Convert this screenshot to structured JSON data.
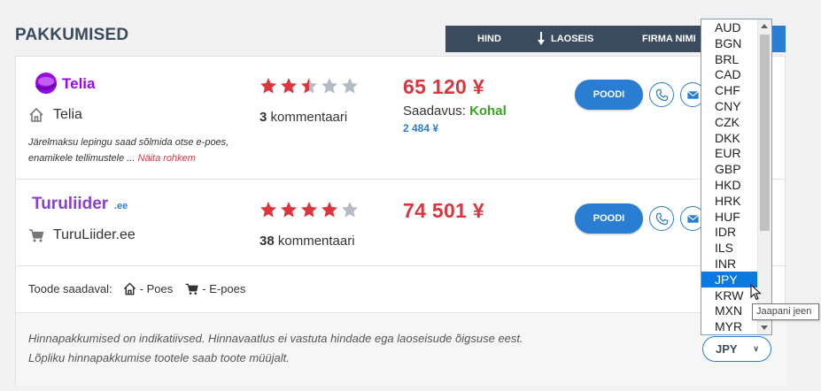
{
  "section": {
    "title": "PAKKUMISED"
  },
  "sort": {
    "hind": "HIND",
    "laoseis": "LAOSEIS",
    "firma": "FIRMA NIMI"
  },
  "offers": [
    {
      "logo_text": "Telia",
      "shop_name": "Telia",
      "shop_type": "physical-store-icon",
      "description": "Järelmaksu lepingu saad sõlmida otse e-poes, enamikele tellimustele ...",
      "more_label": "Näita rohkem",
      "rating": 2.5,
      "comments_count": "3",
      "comments_label": "kommentaari",
      "price": "65 120 ¥",
      "availability_label": "Saadavus:",
      "availability_value": "Kohal",
      "sub_price": "2 484 ¥",
      "buy_label": "POODI"
    },
    {
      "logo_text": "Turuliider",
      "logo_suffix": ".ee",
      "shop_name": "TuruLiider.ee",
      "shop_type": "cart-icon",
      "rating": 4,
      "comments_count": "38",
      "comments_label": "kommentaari",
      "price": "74 501 ¥",
      "buy_label": "POODI"
    }
  ],
  "legend": {
    "label": "Toode saadaval:",
    "store": "- Poes",
    "eshop": "- E-poes"
  },
  "disclaimer": {
    "line1": "Hinnapakkumised on indikatiivsed. Hinnavaatlus ei vastuta hindade ega laoseisude õigsuse eest.",
    "line2": "Lõpliku hinnapakkumise tootele saab toote müüjalt."
  },
  "currency": {
    "options": [
      "AUD",
      "BGN",
      "BRL",
      "CAD",
      "CHF",
      "CNY",
      "CZK",
      "DKK",
      "EUR",
      "GBP",
      "HKD",
      "HRK",
      "HUF",
      "IDR",
      "ILS",
      "INR",
      "JPY",
      "KRW",
      "MXN",
      "MYR"
    ],
    "selected": "JPY",
    "tooltip": "Jaapani jeen"
  },
  "colors": {
    "accent": "#2a7ed2",
    "price": "#d9363e",
    "available": "#3aa31e",
    "navy": "#3a4a5f"
  }
}
